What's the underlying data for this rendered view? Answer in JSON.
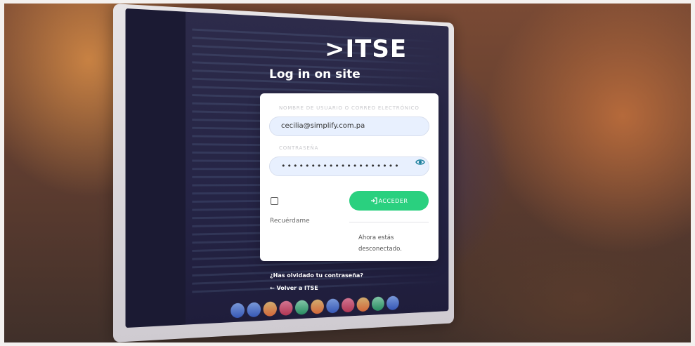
{
  "brand": {
    "logo_text": ">ITSE"
  },
  "page": {
    "title": "Log in on site"
  },
  "form": {
    "username_label": "NOMBRE DE USUARIO O CORREO ELECTRÓNICO",
    "username_value": "cecilia@simplify.com.pa",
    "password_label": "CONTRASEÑA",
    "password_masked": "••••••••••••••••••••",
    "remember_label": "Recuérdame",
    "login_label": "ACCEDER",
    "status_text": "Ahora estás desconectado."
  },
  "links": {
    "forgot": "¿Has olvidado tu contraseña?",
    "back": "← Volver a ITSE"
  },
  "colors": {
    "accent_green": "#2ad07f",
    "input_bg": "#e8f0fe",
    "eye_icon": "#1a7f9c"
  },
  "icons": {
    "password_toggle": "eye-icon",
    "login": "login-arrow-icon"
  }
}
